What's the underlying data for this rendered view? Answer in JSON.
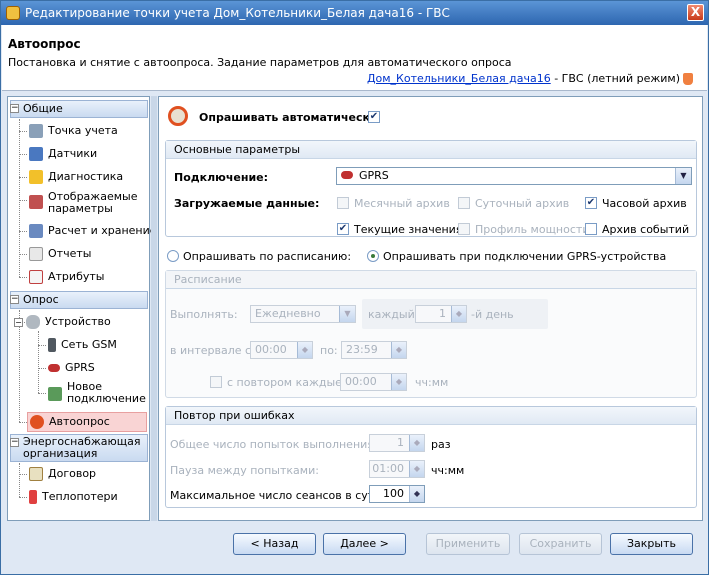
{
  "window": {
    "title": "Редактирование точки учета Дом_Котельники_Белая дача16 - ГВС",
    "close": "X"
  },
  "header": {
    "title": "Автоопрос",
    "description": "Постановка и снятие с автоопроса. Задание параметров для автоматического опроса",
    "link": "Дом_Котельники_Белая дача16",
    "suffix": " - ГВС (летний режим)"
  },
  "nav": {
    "group_general": "Общие",
    "item_point": "Точка учета",
    "item_sensors": "Датчики",
    "item_diag": "Диагностика",
    "item_params": "Отображаемые параметры",
    "item_calc": "Расчет и хранение",
    "item_reports": "Отчеты",
    "item_attrs": "Атрибуты",
    "group_poll": "Опрос",
    "item_device": "Устройство",
    "item_gsm": "Сеть GSM",
    "item_gprs": "GPRS",
    "item_newconn": "Новое подключение",
    "item_autopoll": "Автоопрос",
    "group_energy": "Энергоснабжающая организация",
    "item_contract": "Договор",
    "item_losses": "Теплопотери"
  },
  "main": {
    "autopoll_label": "Опрашивать автоматически",
    "autopoll_checked": true,
    "basic_legend": "Основные параметры",
    "connection_label": "Подключение:",
    "connection_value": "GPRS",
    "loaded_label": "Загружаемые данные:",
    "cb_month": "Месячный архив",
    "cb_day": "Суточный архив",
    "cb_hour": "Часовой архив",
    "cb_current": "Текущие значения",
    "cb_power": "Профиль мощности",
    "cb_events": "Архив событий",
    "radio_schedule": "Опрашивать по расписанию:",
    "radio_gprs": "Опрашивать при подключении GPRS-устройства",
    "schedule_legend": "Расписание",
    "run_label": "Выполнять:",
    "run_value": "Ежедневно",
    "every_value": "каждый",
    "day_value": "1",
    "day_suffix": "-й день",
    "interval_label": "в интервале с:",
    "from_value": "00:00",
    "to_label": "по:",
    "to_value": "23:59",
    "repeat_label": "с повтором каждые:",
    "repeat_value": "00:00",
    "repeat_suffix": "чч:мм",
    "retry_legend": "Повтор при ошибках",
    "attempts_label": "Общее число попыток выполнения:",
    "attempts_value": "1",
    "attempts_suffix": "раз",
    "pause_label": "Пауза между попытками:",
    "pause_value": "01:00",
    "pause_suffix": "чч:мм",
    "sessions_label": "Максимальное число сеансов в сутки:",
    "sessions_value": "100"
  },
  "buttons": {
    "back": "< Назад",
    "next": "Далее >",
    "apply": "Применить",
    "save": "Сохранить",
    "close": "Закрыть"
  },
  "colors": {
    "selected_nav": "#f9d4d4",
    "title_bar": "#2d66b0",
    "link": "#0033cc"
  }
}
